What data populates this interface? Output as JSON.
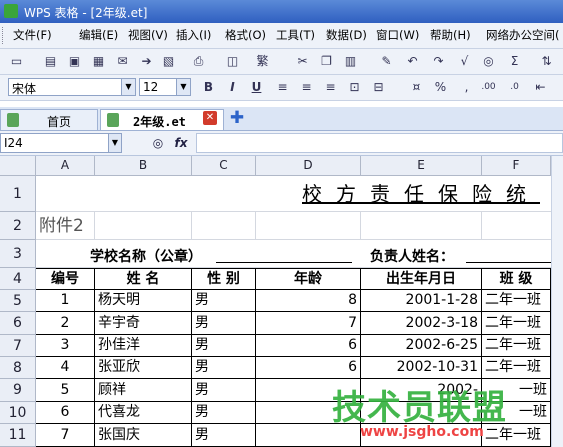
{
  "window": {
    "title": "WPS 表格 - [2年级.et]"
  },
  "menu": [
    "文件(F)",
    "编辑(E)",
    "视图(V)",
    "插入(I)",
    "格式(O)",
    "工具(T)",
    "数据(D)",
    "窗口(W)",
    "帮助(H)",
    "网络办公空间("
  ],
  "format": {
    "font": "宋体",
    "size": "12"
  },
  "tabs": [
    {
      "label": "首页"
    },
    {
      "label": "2年级.et"
    }
  ],
  "namebox": "I24",
  "columns": [
    "A",
    "B",
    "C",
    "D",
    "E",
    "F"
  ],
  "rows": [
    "1",
    "2",
    "3",
    "4",
    "5",
    "6",
    "7",
    "8",
    "9",
    "10",
    "11"
  ],
  "sheet": {
    "title": "校方责任保险统",
    "attachment": "附件2",
    "school_label": "学校名称（公章）",
    "contact_label": "负责人姓名：",
    "headers": [
      "编号",
      "姓  名",
      "性 别",
      "年龄",
      "出生年月日",
      "班 级"
    ],
    "records": [
      {
        "no": "1",
        "name": "杨天明",
        "gender": "男",
        "age": "8",
        "birth": "2001-1-28",
        "class": "二年一班"
      },
      {
        "no": "2",
        "name": "辛宇奇",
        "gender": "男",
        "age": "7",
        "birth": "2002-3-18",
        "class": "二年一班"
      },
      {
        "no": "3",
        "name": "孙佳洋",
        "gender": "男",
        "age": "6",
        "birth": "2002-6-25",
        "class": "二年一班"
      },
      {
        "no": "4",
        "name": "张亚欣",
        "gender": "男",
        "age": "6",
        "birth": "2002-10-31",
        "class": "二年一班"
      },
      {
        "no": "5",
        "name": "顾祥",
        "gender": "男",
        "age": "",
        "birth": "2002-",
        "class": "一班"
      },
      {
        "no": "6",
        "name": "代喜龙",
        "gender": "男",
        "age": "",
        "birth": "",
        "class": "一班"
      },
      {
        "no": "7",
        "name": "张国庆",
        "gender": "男",
        "age": "",
        "birth": "",
        "class": "二年一班"
      }
    ]
  },
  "watermark": {
    "text": "技术员联盟",
    "url": "www.jsgho.com"
  }
}
